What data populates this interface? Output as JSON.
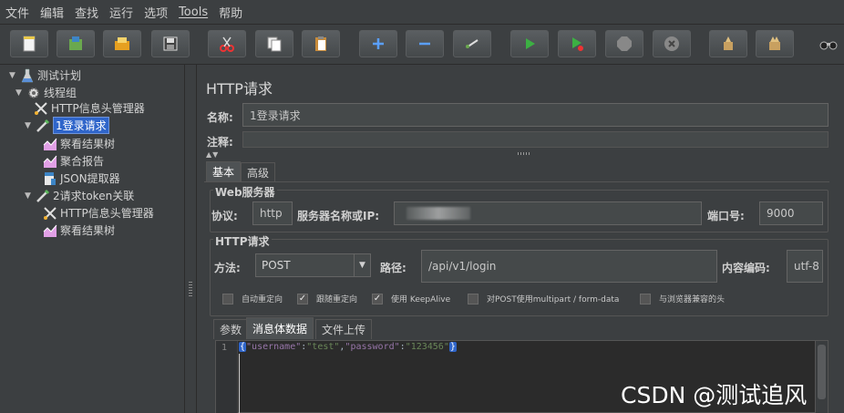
{
  "menu": [
    "文件",
    "编辑",
    "查找",
    "运行",
    "选项",
    "Tools",
    "帮助"
  ],
  "toolbar": {
    "buttons": [
      "new-icon",
      "templates-icon",
      "open-icon",
      "save-icon",
      "cut-icon",
      "copy-icon",
      "paste-icon",
      "expand-icon",
      "collapse-icon",
      "toggle-icon",
      "start-icon",
      "start-no-pause-icon",
      "stop-icon",
      "shutdown-icon",
      "clear-icon",
      "clear-all-icon",
      "search-icon"
    ]
  },
  "tree": {
    "items": [
      {
        "label": "测试计划",
        "icon": "test-plan-icon"
      },
      {
        "label": "线程组",
        "icon": "thread-group-icon"
      },
      {
        "label": "HTTP信息头管理器",
        "icon": "header-manager-icon"
      },
      {
        "label": "1登录请求",
        "icon": "sampler-icon"
      },
      {
        "label": "察看结果树",
        "icon": "listener-icon"
      },
      {
        "label": "聚合报告",
        "icon": "listener-icon"
      },
      {
        "label": "JSON提取器",
        "icon": "extractor-icon"
      },
      {
        "label": "2请求token关联",
        "icon": "sampler-icon"
      },
      {
        "label": "HTTP信息头管理器",
        "icon": "header-manager-icon"
      },
      {
        "label": "察看结果树",
        "icon": "listener-icon"
      }
    ]
  },
  "panel": {
    "title": "HTTP请求",
    "name_label": "名称:",
    "name_value": "1登录请求",
    "comment_label": "注释:",
    "tabs": [
      "基本",
      "高级"
    ],
    "web_server": {
      "section": "Web服务器",
      "protocol_label": "协议:",
      "protocol_value": "http",
      "server_label": "服务器名称或IP:",
      "port_label": "端口号:",
      "port_value": "9000"
    },
    "http_request": {
      "section": "HTTP请求",
      "method_label": "方法:",
      "method_value": "POST",
      "path_label": "路径:",
      "path_value": "/api/v1/login",
      "encoding_label": "内容编码:",
      "encoding_value": "utf-8"
    },
    "checkboxes": [
      {
        "label": "自动重定向",
        "checked": false
      },
      {
        "label": "跟随重定向",
        "checked": true
      },
      {
        "label": "使用 KeepAlive",
        "checked": true
      },
      {
        "label": "对POST使用multipart / form-data",
        "checked": false
      },
      {
        "label": "与浏览器兼容的头",
        "checked": false
      }
    ],
    "body_tabs": [
      "参数",
      "消息体数据",
      "文件上传"
    ],
    "editor": {
      "line_number": "1",
      "open_brace": "{",
      "close_brace": "}",
      "key1": "\"username\"",
      "colon1": ":",
      "val1": "\"test\"",
      "comma": ",",
      "key2": "\"password\"",
      "colon2": ":",
      "val2": "\"123456\""
    }
  },
  "watermark": "CSDN @测试追风"
}
